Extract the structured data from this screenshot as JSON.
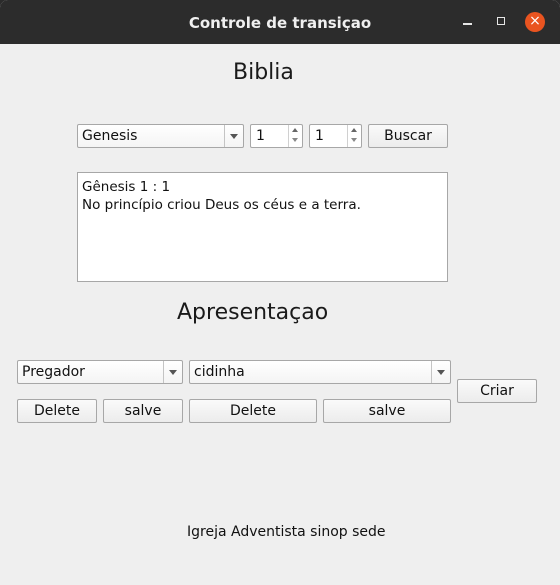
{
  "window": {
    "title": "Controle de transiçao"
  },
  "biblia": {
    "heading": "Biblia",
    "book": "Genesis",
    "chapter": "1",
    "verse": "1",
    "search_label": "Buscar",
    "result_ref": "Gênesis 1 : 1",
    "result_text": "No princípio criou Deus os céus e a terra."
  },
  "apresentacao": {
    "heading": "Apresentaçao",
    "role": "Pregador",
    "name": "cidinha",
    "delete_left": "Delete",
    "save_left": "salve",
    "delete_right": "Delete",
    "save_right": "salve",
    "create_label": "Criar"
  },
  "footer": {
    "text": "Igreja Adventista sinop sede"
  }
}
